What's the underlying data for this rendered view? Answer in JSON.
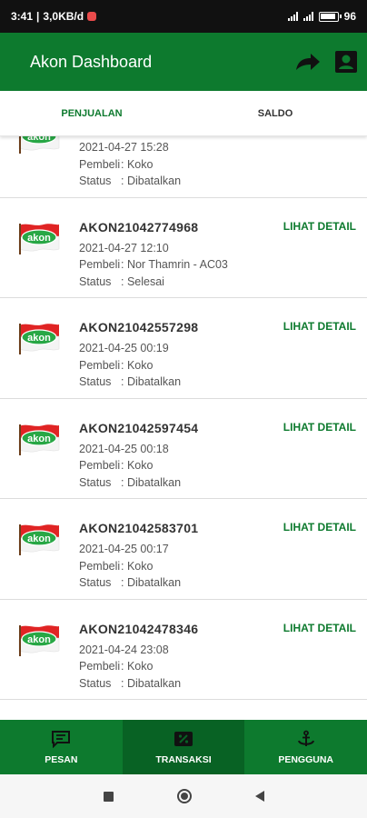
{
  "status_bar": {
    "time": "3:41",
    "speed": "3,0KB/d",
    "battery": "96"
  },
  "app_bar": {
    "title": "Akon Dashboard",
    "icons": [
      "arrow-forward-icon",
      "account-box-icon"
    ]
  },
  "tabs": [
    {
      "label": "PENJUALAN",
      "active": true
    },
    {
      "label": "SALDO",
      "active": false
    }
  ],
  "transactions": [
    {
      "code": "",
      "date": "2021-04-27 15:28",
      "buyer_label": "Pembeli",
      "buyer": "Koko",
      "status_label": "Status",
      "status": "Dibatalkan",
      "detail_label": ""
    },
    {
      "code": "AKON21042774968",
      "date": "2021-04-27 12:10",
      "buyer_label": "Pembeli",
      "buyer": "Nor Thamrin - AC03",
      "status_label": "Status",
      "status": "Selesai",
      "detail_label": "LIHAT DETAIL"
    },
    {
      "code": "AKON21042557298",
      "date": "2021-04-25 00:19",
      "buyer_label": "Pembeli",
      "buyer": "Koko",
      "status_label": "Status",
      "status": "Dibatalkan",
      "detail_label": "LIHAT DETAIL"
    },
    {
      "code": "AKON21042597454",
      "date": "2021-04-25 00:18",
      "buyer_label": "Pembeli",
      "buyer": "Koko",
      "status_label": "Status",
      "status": "Dibatalkan",
      "detail_label": "LIHAT DETAIL"
    },
    {
      "code": "AKON21042583701",
      "date": "2021-04-25 00:17",
      "buyer_label": "Pembeli",
      "buyer": "Koko",
      "status_label": "Status",
      "status": "Dibatalkan",
      "detail_label": "LIHAT DETAIL"
    },
    {
      "code": "AKON21042478346",
      "date": "2021-04-24 23:08",
      "buyer_label": "Pembeli",
      "buyer": "Koko",
      "status_label": "Status",
      "status": "Dibatalkan",
      "detail_label": "LIHAT DETAIL"
    }
  ],
  "logo_text": "akon",
  "bottom_nav": [
    {
      "label": "PESAN",
      "icon": "message-icon",
      "active": false
    },
    {
      "label": "TRANSAKSI",
      "icon": "percent-receipt-icon",
      "active": true
    },
    {
      "label": "PENGGUNA",
      "icon": "anchor-icon",
      "active": false
    }
  ],
  "colors": {
    "primary": "#0d7a2e",
    "primary_dark": "#086224",
    "accent_text": "#0d7a2e"
  }
}
